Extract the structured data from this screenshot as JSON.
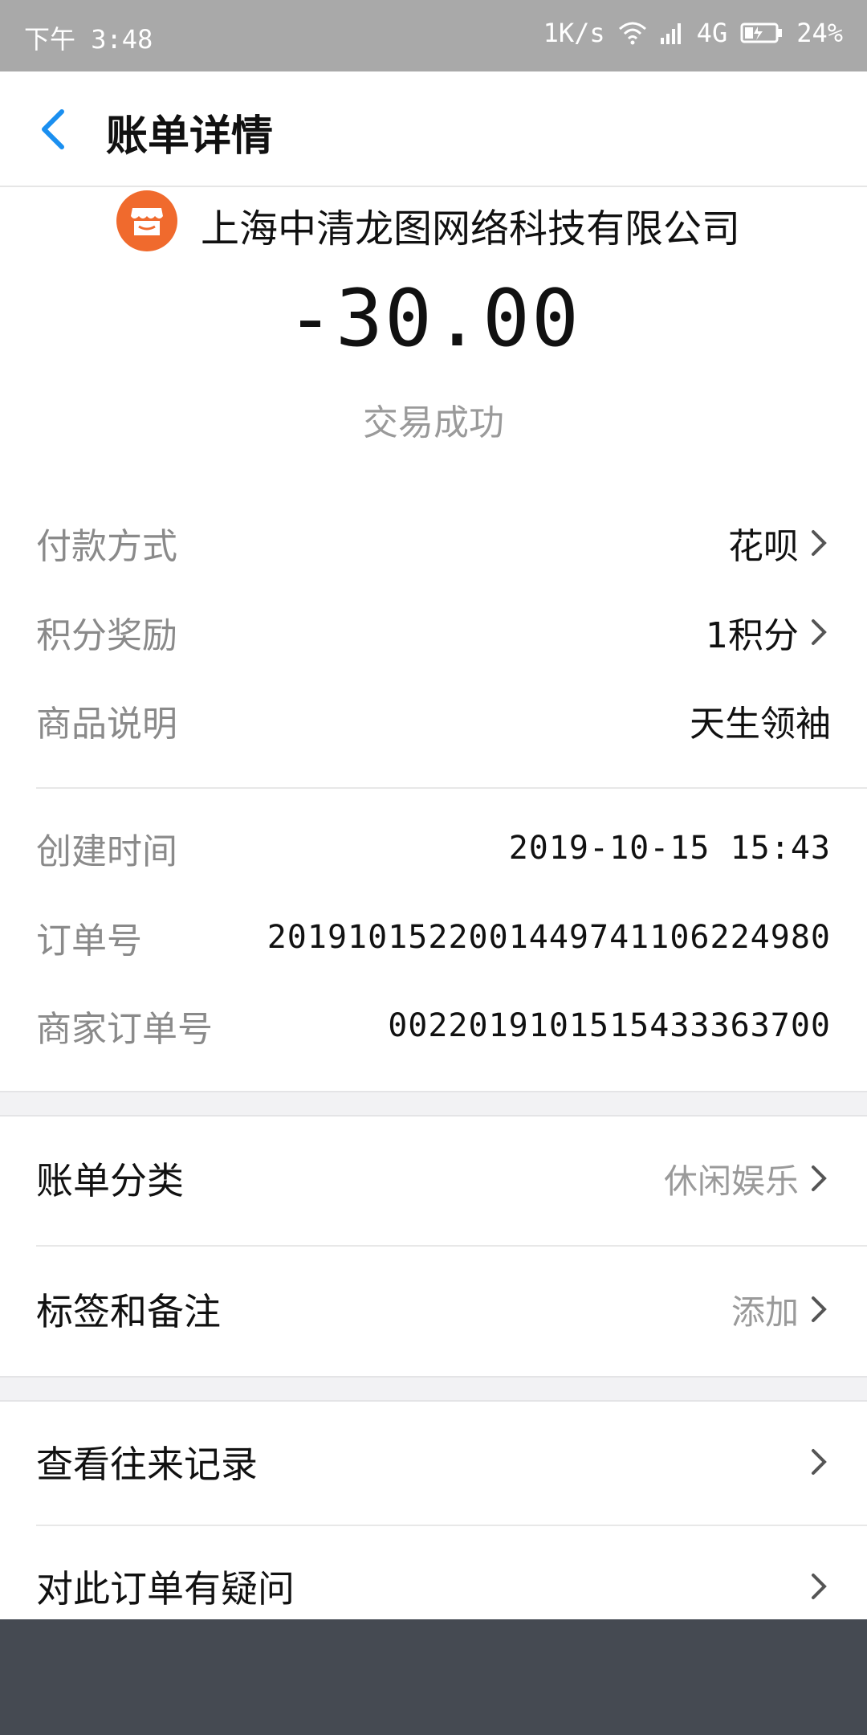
{
  "status_bar": {
    "time": "下午 3:48",
    "speed": "1K/s",
    "network": "4G",
    "battery": "24%"
  },
  "header": {
    "title": "账单详情"
  },
  "merchant": {
    "name": "上海中清龙图网络科技有限公司",
    "logo_color": "#f06a2d"
  },
  "transaction": {
    "amount": "-30.00",
    "status": "交易成功"
  },
  "details_top": [
    {
      "label": "付款方式",
      "value": "花呗"
    },
    {
      "label": "积分奖励",
      "value": "1积分"
    },
    {
      "label": "商品说明",
      "value": "天生领袖"
    }
  ],
  "details_bottom": [
    {
      "label": "创建时间",
      "value": "2019-10-15 15:43"
    },
    {
      "label": "订单号",
      "value": "2019101522001449741106224980"
    },
    {
      "label": "商家订单号",
      "value": "0022019101515433363700"
    }
  ],
  "category_section": [
    {
      "label": "账单分类",
      "value": "休闲娱乐"
    },
    {
      "label": "标签和备注",
      "value": "添加"
    }
  ],
  "action_section": [
    {
      "label": "查看往来记录"
    },
    {
      "label": "对此订单有疑问"
    }
  ],
  "colors": {
    "accent": "#1a8ff0",
    "status_bar": "#a9a9a9",
    "bottom_bar": "#454a52"
  }
}
